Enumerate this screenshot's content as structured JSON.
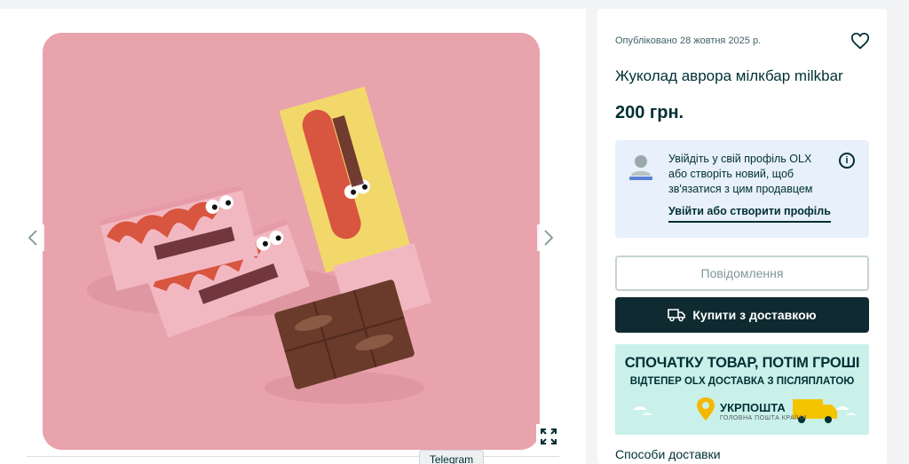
{
  "gallery": {
    "prev_icon": "chevron-left-icon",
    "next_icon": "chevron-right-icon",
    "expand_icon": "expand-icon",
    "telegram_tooltip": "Telegram"
  },
  "listing": {
    "published": "Опубліковано 28 жовтня 2025 р.",
    "title": "Жуколад аврора мілкбар milkbar",
    "price": "200 грн."
  },
  "login_prompt": {
    "text": "Увійдіть у свій профіль OLX або створіть новий, щоб зв'язатися з цим продавцем",
    "link": "Увійти або створити профіль"
  },
  "buttons": {
    "message": "Повідомлення",
    "buy": "Купити з доставкою"
  },
  "banner": {
    "headline": "СПОЧАТКУ ТОВАР, ПОТІМ ГРОШІ",
    "subheadline": "ВІДТЕПЕР OLX ДОСТАВКА З ПІСЛЯПЛАТОЮ",
    "brand": "УКРПОШТА",
    "brand_sub": "ГОЛОВНА ПОШТА КРАЇНИ"
  },
  "delivery": {
    "title": "Способи доставки"
  },
  "colors": {
    "primary": "#002f34",
    "buy_button": "#0f2a30",
    "banner_bg": "#c9f1ea",
    "login_bg": "#e7f0fb"
  }
}
